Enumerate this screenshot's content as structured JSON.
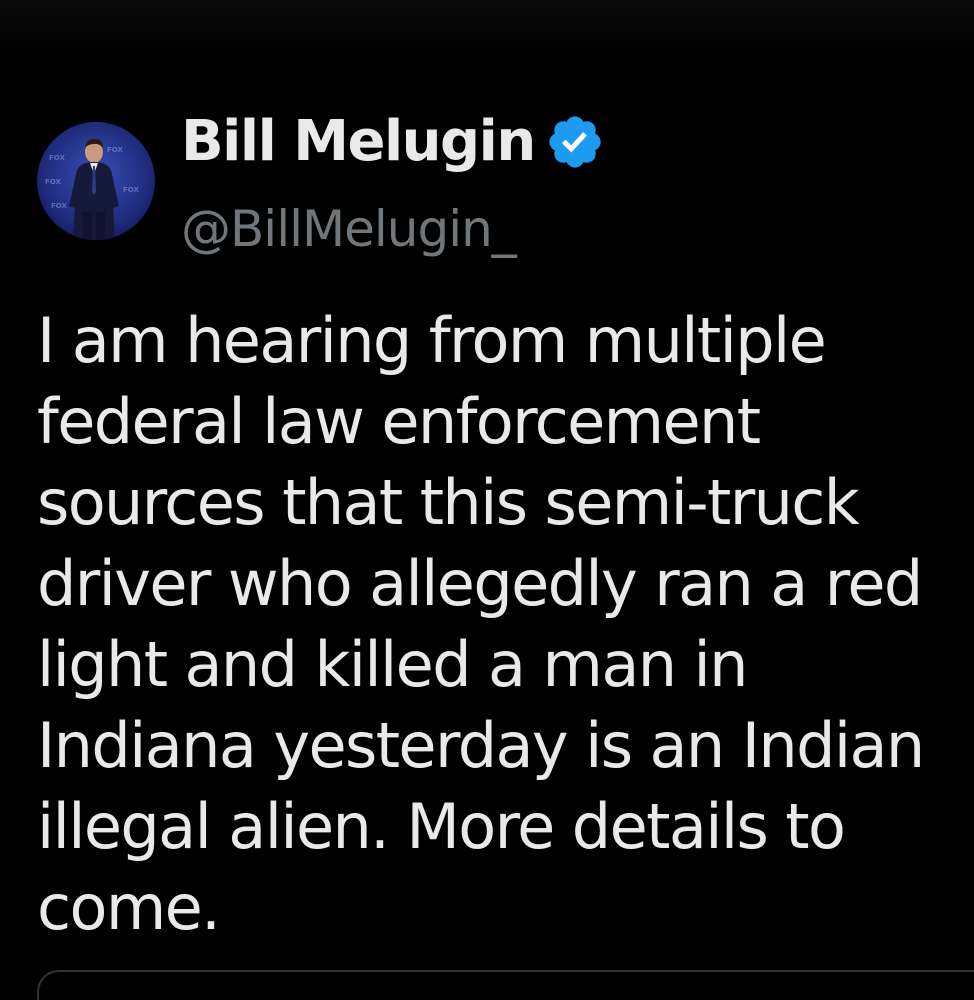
{
  "tweet": {
    "author": {
      "display_name": "Bill Melugin",
      "handle": "@BillMelugin_",
      "verified": true,
      "verified_icon": "verified-badge-icon",
      "verified_color": "#1d9bf0",
      "avatar_icon": "avatar-photo"
    },
    "text_lines": [
      "I am hearing from multiple",
      "federal law enforcement",
      "sources that this semi-truck",
      "driver who allegedly ran a red",
      "light and killed a man in",
      "Indiana yesterday is an Indian",
      "illegal alien. More details to",
      "come."
    ]
  },
  "colors": {
    "background": "#000000",
    "primary_text": "#e7e9ea",
    "secondary_text": "#71767b",
    "accent": "#1d9bf0"
  }
}
